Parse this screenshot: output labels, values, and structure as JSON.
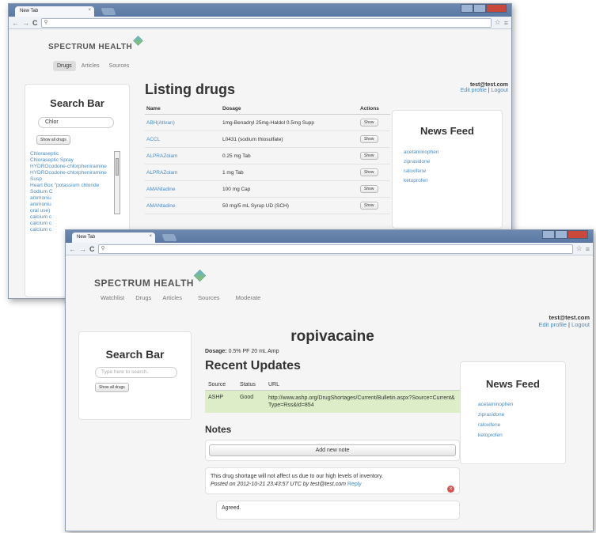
{
  "back_window": {
    "tab_title": "New Tab",
    "tab_close": "×",
    "url": "",
    "brand": "SPECTRUM HEALTH",
    "nav": [
      "Drugs",
      "Articles",
      "Sources"
    ],
    "user_email": "test@test.com",
    "edit_profile": "Edit profile",
    "separator": "|",
    "logout": "Logout",
    "search_title": "Search Bar",
    "search_value": "Chlor",
    "show_all": "Show all drugs",
    "search_results": [
      "Chloraseptic",
      "Chloraseptic Spray",
      "HYDROcodone-chlorpheniramine",
      "HYDROcodone-chlorpheniramine Susp",
      "Heart Box \"potassium chloride",
      "Sodium C",
      "ammoniu",
      "ammoniu",
      "oral use)",
      "calcium c",
      "calcium c",
      "calcium c"
    ],
    "heading": "Listing drugs",
    "columns": [
      "Name",
      "Dosage",
      "Actions"
    ],
    "rows": [
      {
        "name": "ABH(Ativan)",
        "dosage": "1mg-Benadryl 25mg-Haldol 0.5mg Supp",
        "action": "Show"
      },
      {
        "name": "ACCL",
        "dosage": "L0431 (sodium thiosulfate)",
        "action": "Show"
      },
      {
        "name": "ALPRAZolam",
        "dosage": "0.25 mg Tab",
        "action": "Show"
      },
      {
        "name": "ALPRAZolam",
        "dosage": "1 mg Tab",
        "action": "Show"
      },
      {
        "name": "AMANtadine",
        "dosage": "100 mg Cap",
        "action": "Show"
      },
      {
        "name": "AMANtadine",
        "dosage": "50 mg/5 mL Syrup UD (SCH)",
        "action": "Show"
      }
    ],
    "news_title": "News Feed",
    "news": [
      "acetaminophen",
      "ziprasidone",
      "raloxifene",
      "ketoprofen"
    ]
  },
  "front_window": {
    "tab_title": "New Tab",
    "tab_close": "×",
    "url": "",
    "brand": "SPECTRUM HEALTH",
    "nav": [
      "Watchlist",
      "Drugs",
      "Articles",
      "Sources",
      "Moderate"
    ],
    "user_email": "test@test.com",
    "edit_profile": "Edit profile",
    "separator": "|",
    "logout": "Logout",
    "search_title": "Search Bar",
    "search_placeholder": "Type here to search.",
    "show_all": "Show all drugs",
    "drug_name": "ropivacaine",
    "dosage_label": "Dosage:",
    "dosage_value": "0.5% PF 20 mL Amp",
    "updates_heading": "Recent Updates",
    "updates_columns": [
      "Source",
      "Status",
      "URL"
    ],
    "update_row": {
      "source": "ASHP",
      "status": "Good",
      "url": "http://www.ashp.org/DrugShortages/Current/Bulletin.aspx?Source=Current&Type=Rss&Id=854"
    },
    "notes_heading": "Notes",
    "add_note": "Add new note",
    "note1_text": "This drug shortage will not affect us due to our high levels of inventory.",
    "note1_meta": "Posted on 2012-10-21 23:43:57 UTC by test@test.com",
    "note1_reply": "Reply",
    "note2_text": "Agreed.",
    "news_title": "News Feed",
    "news": [
      "acetaminophen",
      "ziprasidone",
      "raloxifene",
      "ketoprofen"
    ]
  },
  "colors": {
    "titlebar": "#5a78a3",
    "link": "#4a8bc2",
    "close_red": "#c9483c",
    "update_row_bg": "#dcedc8"
  }
}
